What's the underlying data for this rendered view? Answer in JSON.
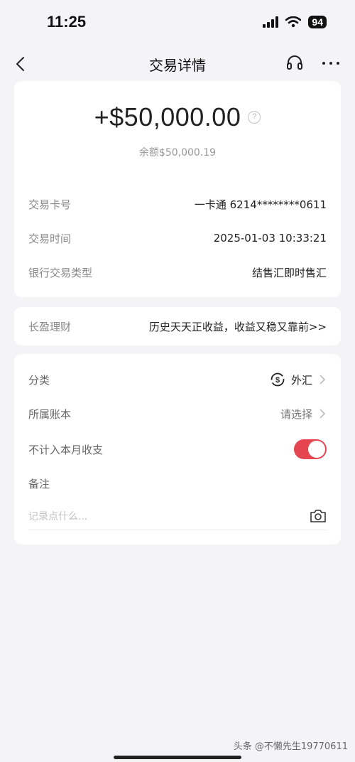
{
  "status": {
    "time": "11:25",
    "battery": "94"
  },
  "nav": {
    "title": "交易详情"
  },
  "transaction": {
    "amount": "+$50,000.00",
    "help_glyph": "?",
    "balance": "余额$50,000.19",
    "details": [
      {
        "label": "交易卡号",
        "value": "一卡通 6214********0611"
      },
      {
        "label": "交易时间",
        "value": "2025-01-03 10:33:21"
      },
      {
        "label": "银行交易类型",
        "value": "结售汇即时售汇"
      }
    ]
  },
  "promo": {
    "label": "长盈理财",
    "text": "历史天天正收益，收益又稳又靠前>>"
  },
  "settings": {
    "category_label": "分类",
    "category_value": "外汇",
    "account_label": "所属账本",
    "account_value": "请选择",
    "exclude_label": "不计入本月收支",
    "exclude_enabled": true,
    "note_label": "备注",
    "note_placeholder": "记录点什么..."
  },
  "watermark": "头条 @不懒先生19770611",
  "icons": {
    "back": "chevron-left-icon",
    "headset": "headset-icon",
    "more": "more-icon",
    "category": "currency-exchange-icon",
    "camera": "camera-icon"
  },
  "colors": {
    "toggle_on": "#e5454f",
    "background": "#f4f4f6"
  }
}
